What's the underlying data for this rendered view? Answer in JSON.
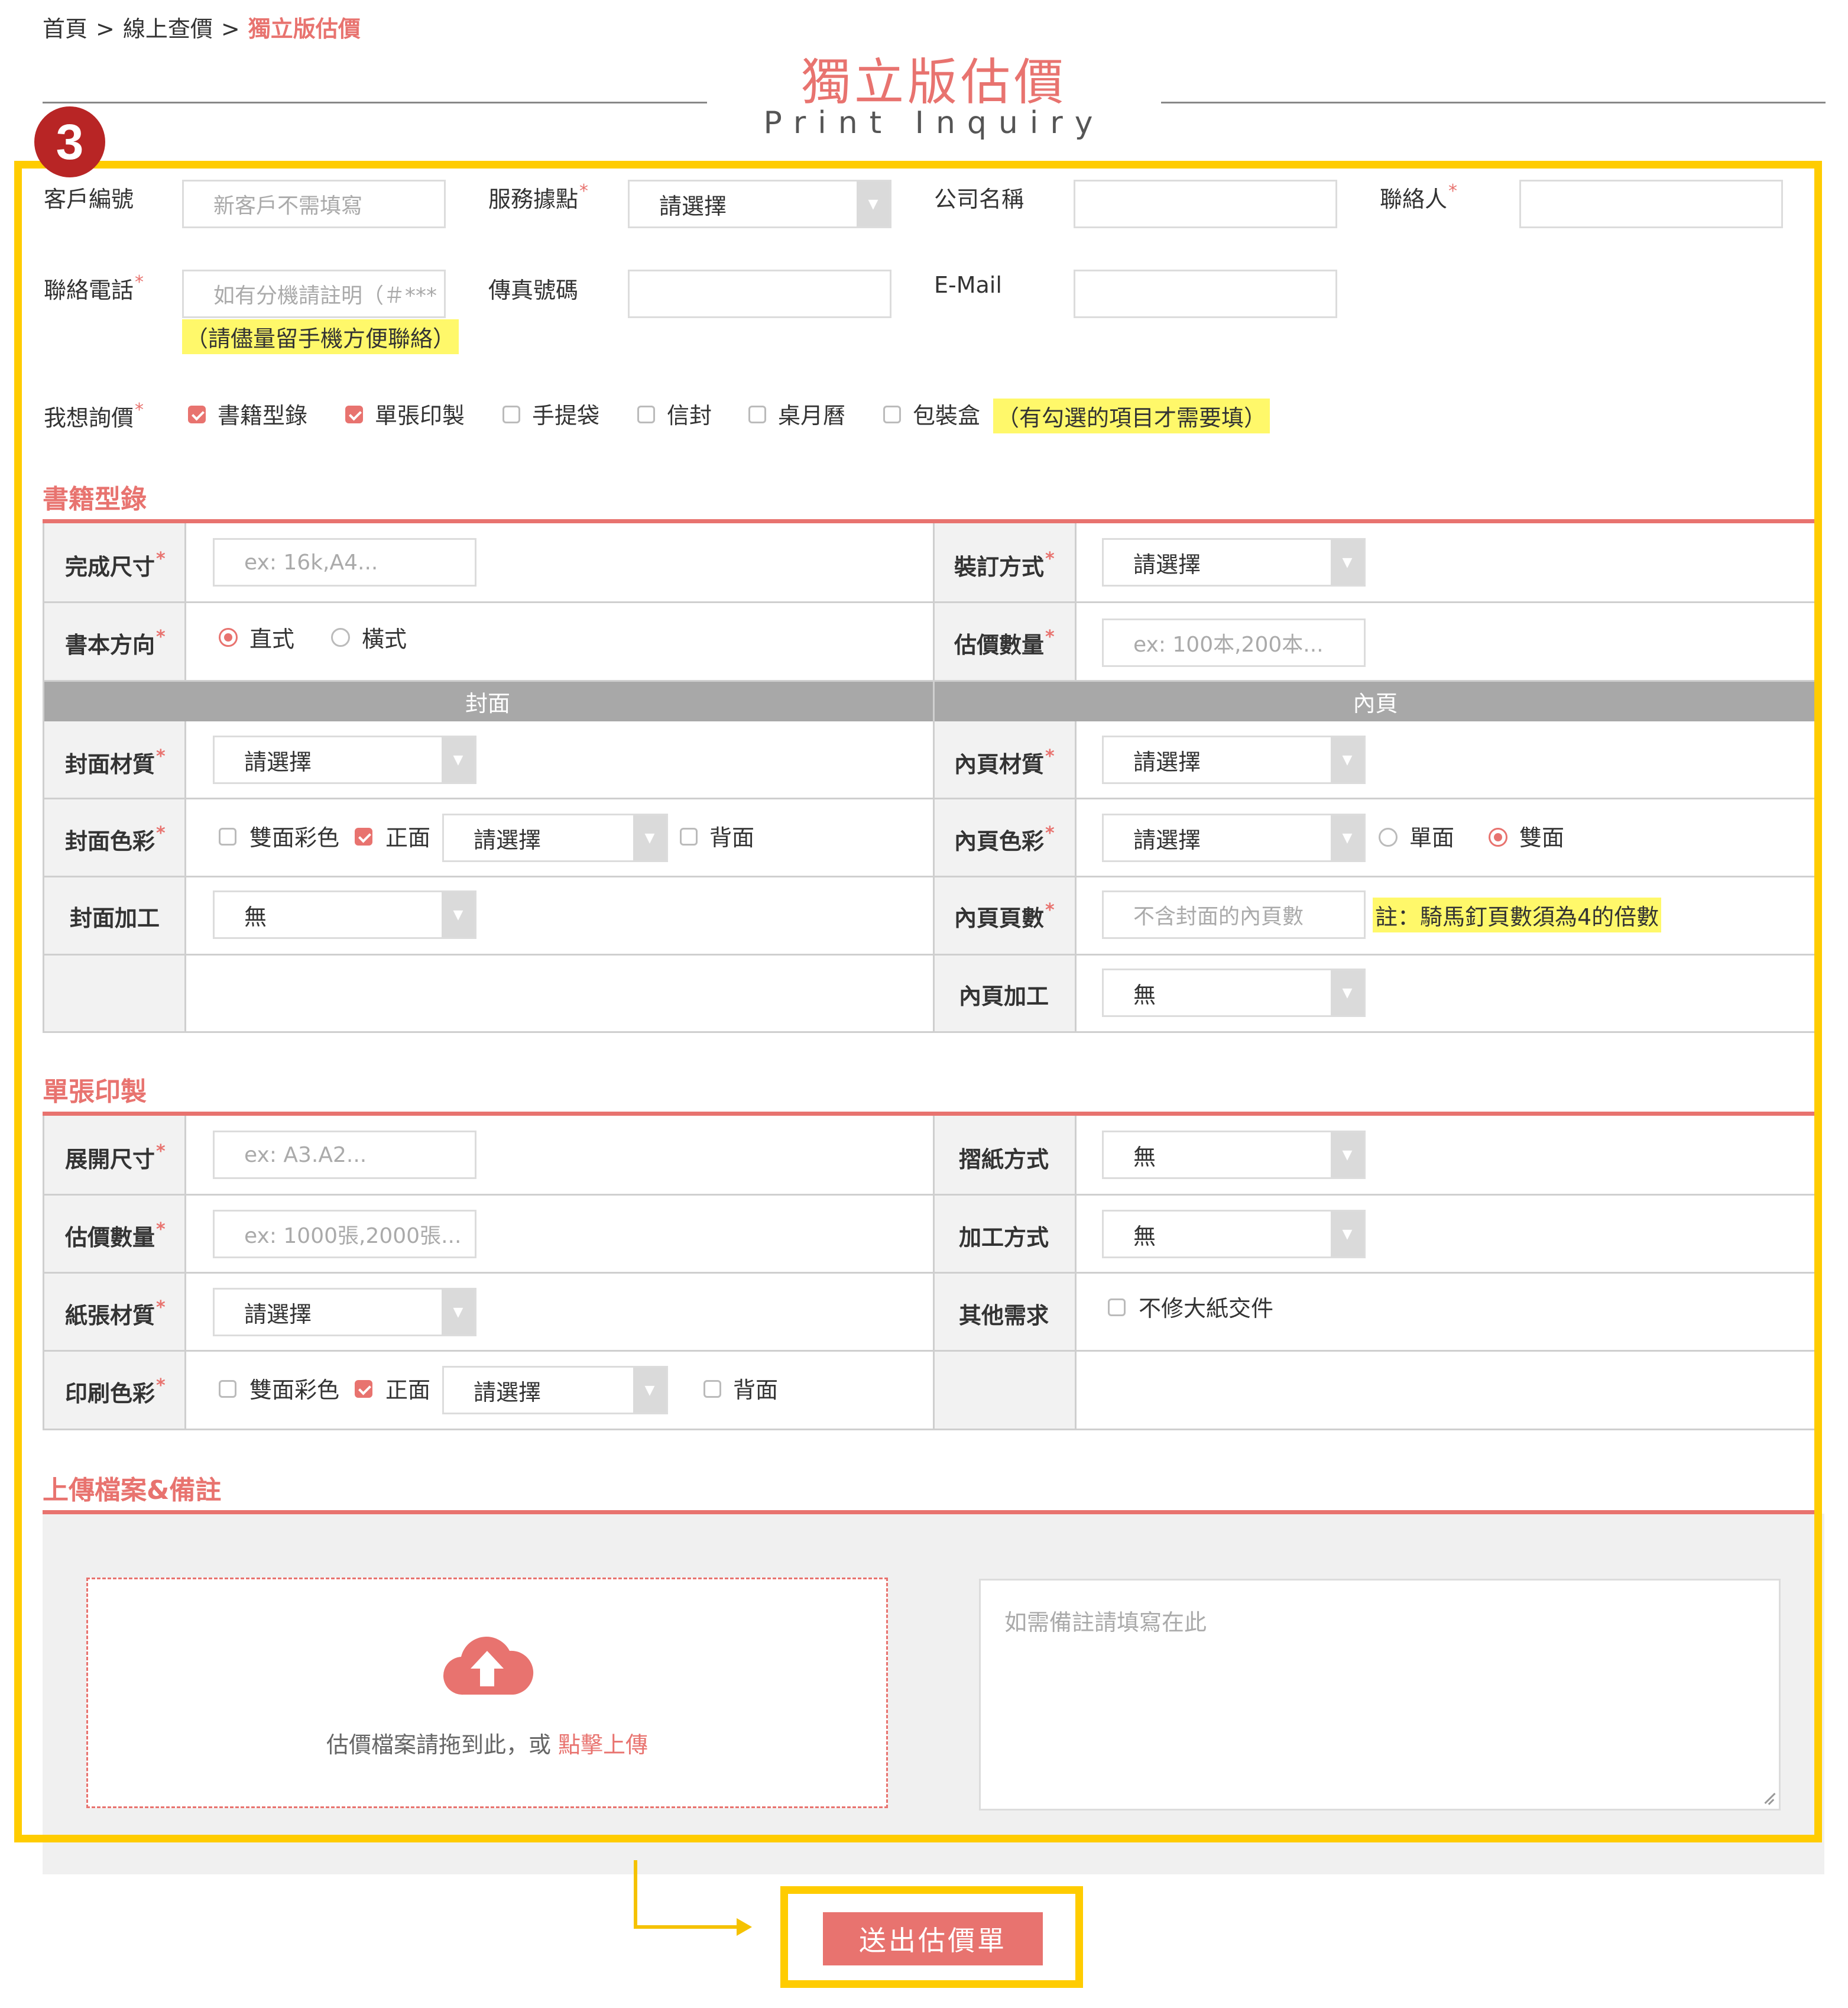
{
  "breadcrumb": {
    "home": "首頁",
    "sep": ">",
    "level2": "線上查價",
    "current": "獨立版估價"
  },
  "title": {
    "zh": "獨立版估價",
    "en": "Print Inquiry"
  },
  "step": "3",
  "contact": {
    "customer_id_label": "客戶編號",
    "customer_id_placeholder": "新客戶不需填寫",
    "service_point_label": "服務據點",
    "service_point_value": "請選擇",
    "company_label": "公司名稱",
    "contact_person_label": "聯絡人",
    "phone_label": "聯絡電話",
    "phone_placeholder": "如有分機請註明（＃***",
    "phone_note": "（請儘量留手機方便聯絡）",
    "fax_label": "傳真號碼",
    "email_label": "E-Mail",
    "inquiry_label": "我想詢價",
    "inquiry_options": [
      {
        "label": "書籍型錄",
        "checked": true
      },
      {
        "label": "單張印製",
        "checked": true
      },
      {
        "label": "手提袋",
        "checked": false
      },
      {
        "label": "信封",
        "checked": false
      },
      {
        "label": "桌月曆",
        "checked": false
      },
      {
        "label": "包裝盒",
        "checked": false
      }
    ],
    "inquiry_note": "（有勾選的項目才需要填）",
    "required_mark": "*"
  },
  "book": {
    "section_title": "書籍型錄",
    "size_label": "完成尺寸",
    "size_placeholder": "ex: 16k,A4...",
    "binding_label": "裝訂方式",
    "binding_value": "請選擇",
    "direction_label": "書本方向",
    "direction_portrait": "直式",
    "direction_landscape": "橫式",
    "quantity_label": "估價數量",
    "quantity_placeholder": "ex: 100本,200本...",
    "cover_header": "封面",
    "inner_header": "內頁",
    "cover_material_label": "封面材質",
    "cover_material_value": "請選擇",
    "inner_material_label": "內頁材質",
    "inner_material_value": "請選擇",
    "cover_color_label": "封面色彩",
    "duplex_label": "雙面彩色",
    "front_label": "正面",
    "front_value": "請選擇",
    "back_label": "背面",
    "inner_color_label": "內頁色彩",
    "inner_color_value": "請選擇",
    "single_side": "單面",
    "double_side": "雙面",
    "cover_process_label": "封面加工",
    "cover_process_value": "無",
    "inner_pages_label": "內頁頁數",
    "inner_pages_placeholder": "不含封面的內頁數",
    "inner_pages_note": "註：騎馬釘頁數須為4的倍數",
    "inner_process_label": "內頁加工",
    "inner_process_value": "無"
  },
  "single": {
    "section_title": "單張印製",
    "size_label": "展開尺寸",
    "size_placeholder": "ex: A3.A2...",
    "fold_label": "摺紙方式",
    "fold_value": "無",
    "quantity_label": "估價數量",
    "quantity_placeholder": "ex: 1000張,2000張...",
    "process_label": "加工方式",
    "process_value": "無",
    "paper_label": "紙張材質",
    "paper_value": "請選擇",
    "other_label": "其他需求",
    "other_option": "不修大紙交件",
    "color_label": "印刷色彩",
    "duplex_label": "雙面彩色",
    "front_label": "正面",
    "front_value": "請選擇",
    "back_label": "背面"
  },
  "upload": {
    "section_title": "上傳檔案&備註",
    "drop_text": "估價檔案請拖到此，或",
    "click_text": "點擊上傳",
    "remarks_placeholder": "如需備註請填寫在此"
  },
  "submit_label": "送出估價單",
  "colors": {
    "accent": "#e8736f",
    "highlight": "#fff86a",
    "frame": "#ffcc00",
    "badge": "#b82525"
  },
  "icons": {
    "upload": "cloud-upload-icon",
    "dropdown": "caret-down-icon"
  }
}
